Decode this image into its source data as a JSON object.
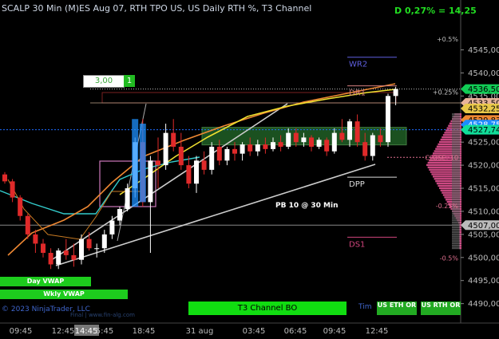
{
  "header": {
    "title": "SCALP 30 Min (M)ES Aug 07, RTH TPO US, US Daily RTH %, T3 Channel",
    "delta": "D 0,27% = 14,25"
  },
  "chart_data": {
    "type": "candlestick",
    "ylim": [
      4487,
      4552
    ],
    "y_ticks": [
      4545,
      4540,
      4535,
      4530,
      4525,
      4520,
      4515,
      4510,
      4505,
      4500,
      4495,
      4490
    ],
    "y_tick_labels": [
      "4545,00",
      "4540,00",
      "4535,00",
      "4530,00",
      "4525,00",
      "4520,00",
      "4515,00",
      "4510,00",
      "4505,00",
      "4500,00",
      "4495,00",
      "4490,00"
    ],
    "x_ticks": [
      "09:45",
      "12:45",
      "14:45",
      "5:45",
      "18:45",
      "31 aug",
      "03:45",
      "06:45",
      "09:45",
      "12:45"
    ],
    "candles": [
      {
        "o": 4518,
        "h": 4518.5,
        "l": 4516,
        "c": 4516.5
      },
      {
        "o": 4516.5,
        "h": 4517,
        "l": 4512,
        "c": 4513
      },
      {
        "o": 4513,
        "h": 4513.5,
        "l": 4508,
        "c": 4509
      },
      {
        "o": 4509,
        "h": 4509.5,
        "l": 4504,
        "c": 4505
      },
      {
        "o": 4505,
        "h": 4506,
        "l": 4501,
        "c": 4503
      },
      {
        "o": 4503,
        "h": 4504,
        "l": 4500,
        "c": 4501
      },
      {
        "o": 4501,
        "h": 4502,
        "l": 4497.5,
        "c": 4498.5
      },
      {
        "o": 4498.5,
        "h": 4502,
        "l": 4497.5,
        "c": 4501.5
      },
      {
        "o": 4501.5,
        "h": 4504,
        "l": 4499.5,
        "c": 4500.5
      },
      {
        "o": 4500.5,
        "h": 4503,
        "l": 4498,
        "c": 4499.5
      },
      {
        "o": 4499.5,
        "h": 4505,
        "l": 4498.5,
        "c": 4504
      },
      {
        "o": 4504,
        "h": 4505.5,
        "l": 4501.5,
        "c": 4502
      },
      {
        "o": 4502,
        "h": 4503,
        "l": 4500,
        "c": 4502
      },
      {
        "o": 4502,
        "h": 4506,
        "l": 4501,
        "c": 4505
      },
      {
        "o": 4505,
        "h": 4509,
        "l": 4504,
        "c": 4508
      },
      {
        "o": 4508,
        "h": 4511,
        "l": 4507,
        "c": 4510.5
      },
      {
        "o": 4510.5,
        "h": 4516,
        "l": 4510,
        "c": 4515
      },
      {
        "o": 4515,
        "h": 4526,
        "l": 4513,
        "c": 4525
      },
      {
        "o": 4525,
        "h": 4530,
        "l": 4511,
        "c": 4512
      },
      {
        "o": 4512,
        "h": 4522,
        "l": 4501,
        "c": 4521
      },
      {
        "o": 4521,
        "h": 4526,
        "l": 4515,
        "c": 4520
      },
      {
        "o": 4520,
        "h": 4529,
        "l": 4519,
        "c": 4527
      },
      {
        "o": 4527,
        "h": 4530,
        "l": 4523,
        "c": 4524
      },
      {
        "o": 4524,
        "h": 4527,
        "l": 4519,
        "c": 4520
      },
      {
        "o": 4520,
        "h": 4522,
        "l": 4515,
        "c": 4516
      },
      {
        "o": 4516,
        "h": 4522,
        "l": 4514,
        "c": 4521
      },
      {
        "o": 4521,
        "h": 4523,
        "l": 4518,
        "c": 4519
      },
      {
        "o": 4519,
        "h": 4525,
        "l": 4518,
        "c": 4524
      },
      {
        "o": 4524,
        "h": 4525.5,
        "l": 4520,
        "c": 4521
      },
      {
        "o": 4521,
        "h": 4524,
        "l": 4520,
        "c": 4523.5
      },
      {
        "o": 4523.5,
        "h": 4525,
        "l": 4521,
        "c": 4522.5
      },
      {
        "o": 4522.5,
        "h": 4525,
        "l": 4521,
        "c": 4524.5
      },
      {
        "o": 4524.5,
        "h": 4526,
        "l": 4522,
        "c": 4523
      },
      {
        "o": 4523,
        "h": 4525.5,
        "l": 4522,
        "c": 4524.5
      },
      {
        "o": 4524.5,
        "h": 4526,
        "l": 4522.5,
        "c": 4523.5
      },
      {
        "o": 4523.5,
        "h": 4526,
        "l": 4523,
        "c": 4525
      },
      {
        "o": 4525,
        "h": 4526.5,
        "l": 4523,
        "c": 4524
      },
      {
        "o": 4524,
        "h": 4528,
        "l": 4523.5,
        "c": 4527
      },
      {
        "o": 4527,
        "h": 4528,
        "l": 4524,
        "c": 4525
      },
      {
        "o": 4525,
        "h": 4527,
        "l": 4524,
        "c": 4526
      },
      {
        "o": 4526,
        "h": 4526.5,
        "l": 4523,
        "c": 4524
      },
      {
        "o": 4524,
        "h": 4526,
        "l": 4523.5,
        "c": 4525.5
      },
      {
        "o": 4525.5,
        "h": 4526,
        "l": 4522,
        "c": 4523
      },
      {
        "o": 4523,
        "h": 4528,
        "l": 4522.5,
        "c": 4527
      },
      {
        "o": 4527,
        "h": 4530,
        "l": 4525,
        "c": 4525.5
      },
      {
        "o": 4525.5,
        "h": 4530,
        "l": 4524,
        "c": 4529.5
      },
      {
        "o": 4529.5,
        "h": 4531,
        "l": 4524,
        "c": 4525
      },
      {
        "o": 4525,
        "h": 4527,
        "l": 4521,
        "c": 4522
      },
      {
        "o": 4522,
        "h": 4527,
        "l": 4521,
        "c": 4526.5
      },
      {
        "o": 4526.5,
        "h": 4528,
        "l": 4524,
        "c": 4525
      },
      {
        "o": 4525,
        "h": 4535.5,
        "l": 4524,
        "c": 4535
      },
      {
        "o": 4535,
        "h": 4537,
        "l": 4533,
        "c": 4536.5
      }
    ],
    "level_lines": [
      {
        "label": "WR2",
        "value": 4543.4,
        "color": "#5f5fe0"
      },
      {
        "label": "DR1",
        "value": 4537.2,
        "color": "#d58080"
      },
      {
        "label": "DPP",
        "value": 4517.4,
        "color": "#dddddd"
      },
      {
        "label": "DS1",
        "value": 4504.4,
        "color": "#d1457d"
      }
    ],
    "percent_labels": [
      {
        "text": "+0.5%",
        "value": 4547.3,
        "color": "#bbbbbb"
      },
      {
        "text": "+0.25%",
        "value": 4535.8,
        "color": "#cccccc"
      },
      {
        "text": "CLOSE: 10",
        "value": 4521.7,
        "color": "#e07090"
      },
      {
        "text": "-0.25%",
        "value": 4511.2,
        "color": "#e07090"
      },
      {
        "text": "-0.5%",
        "value": 4499.9,
        "color": "#e07090"
      }
    ],
    "price_labels": [
      {
        "text": "4536,50",
        "value": 4536.5,
        "bg": "#11cc55",
        "fg": "#000"
      },
      {
        "text": "4533,50",
        "value": 4533.5,
        "bg": "#e8b49a",
        "fg": "#000"
      },
      {
        "text": "4532,25",
        "value": 4532.3,
        "bg": "#e8c84a",
        "fg": "#000"
      },
      {
        "text": "4529,83",
        "value": 4529.8,
        "bg": "#ee8833",
        "fg": "#000"
      },
      {
        "text": "4528,75",
        "value": 4528.8,
        "bg": "#1e8cff",
        "fg": "#fff"
      },
      {
        "text": "4527,74",
        "value": 4527.7,
        "bg": "#11dd99",
        "fg": "#000"
      },
      {
        "text": "4507,00",
        "value": 4507.0,
        "bg": "#bbbbbb",
        "fg": "#000"
      }
    ],
    "annotations": {
      "pb": "PB 10 @ 30 Min"
    }
  },
  "order_entry": {
    "quantity": "3,00",
    "button": "1"
  },
  "badges": {
    "day_vwap": "Day VWAP",
    "wkly_vwap": "Wkly VWAP",
    "t3": "T3 Channel BO",
    "rth1": "US ETH OR",
    "rth2": "US RTH OR",
    "time_label": "Tim"
  },
  "footer": {
    "copyright": "© 2023 NinjaTrader, LLC",
    "url_faded": "Final | www.fin-alg.com"
  },
  "colors": {
    "up_candle": "#ffffff",
    "down_candle": "#e02a2a",
    "ema_orange": "#ee8833",
    "ema_yellow": "#f0e030",
    "cyan_line": "#33cccc",
    "trend_line": "#cccccc",
    "tpo_profile": "#ee5599",
    "channel_fill": "#1f5a24"
  }
}
